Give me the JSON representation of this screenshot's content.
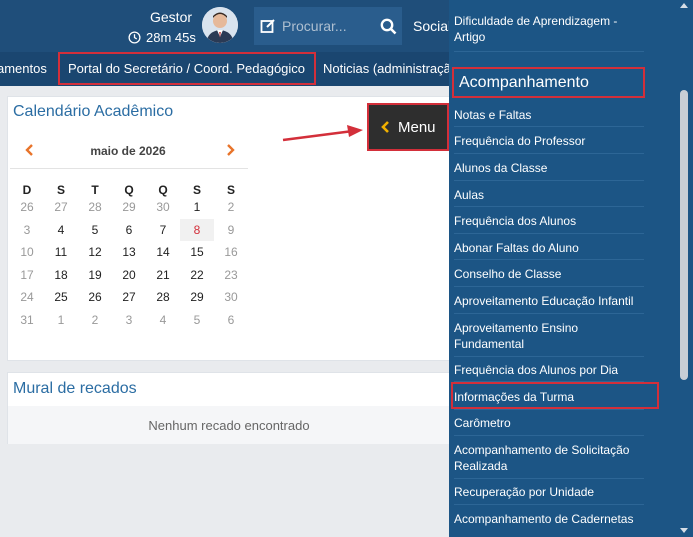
{
  "header": {
    "user_name": "Gestor",
    "timer": "28m 45s",
    "search_placeholder": "Procurar...",
    "social_label": "Social"
  },
  "nav": {
    "items": [
      "amentos",
      "Portal do Secretário / Coord. Pedagógico",
      "Noticias (administraçã"
    ]
  },
  "calendar": {
    "title": "Calendário Acadêmico",
    "month": "maio de 2026",
    "weekdays": [
      "D",
      "S",
      "T",
      "Q",
      "Q",
      "S",
      "S"
    ],
    "weeks": [
      [
        "26",
        "27",
        "28",
        "29",
        "30",
        "1",
        "2"
      ],
      [
        "3",
        "4",
        "5",
        "6",
        "7",
        "8",
        "9"
      ],
      [
        "10",
        "11",
        "12",
        "13",
        "14",
        "15",
        "16"
      ],
      [
        "17",
        "18",
        "19",
        "20",
        "21",
        "22",
        "23"
      ],
      [
        "24",
        "25",
        "26",
        "27",
        "28",
        "29",
        "30"
      ],
      [
        "31",
        "1",
        "2",
        "3",
        "4",
        "5",
        "6"
      ]
    ],
    "today": "8"
  },
  "mural": {
    "title": "Mural de recados",
    "empty_text": "Nenhum recado encontrado"
  },
  "menu_button": {
    "label": "Menu"
  },
  "side_menu": {
    "top_item": "Dificuldade de Aprendizagem - Artigo",
    "section_title": "Acompanhamento",
    "items": [
      "Notas e Faltas",
      "Frequência do Professor",
      "Alunos da Classe",
      "Aulas",
      "Frequência dos Alunos",
      "Abonar Faltas do Aluno",
      "Conselho de Classe",
      "Aproveitamento Educação Infantil",
      "Aproveitamento Ensino Fundamental",
      "Frequência dos Alunos por Dia",
      "Informações da Turma",
      "Carômetro",
      "Acompanhamento de Solicitação Realizada",
      "Recuperação por Unidade",
      "Acompanhamento de Cadernetas"
    ]
  },
  "colors": {
    "header_bg": "#1f4e7a",
    "side_bg": "#1c5585",
    "highlight_border": "#d32f3a",
    "title_blue": "#2b6da3",
    "accent_orange": "#e8742a"
  }
}
